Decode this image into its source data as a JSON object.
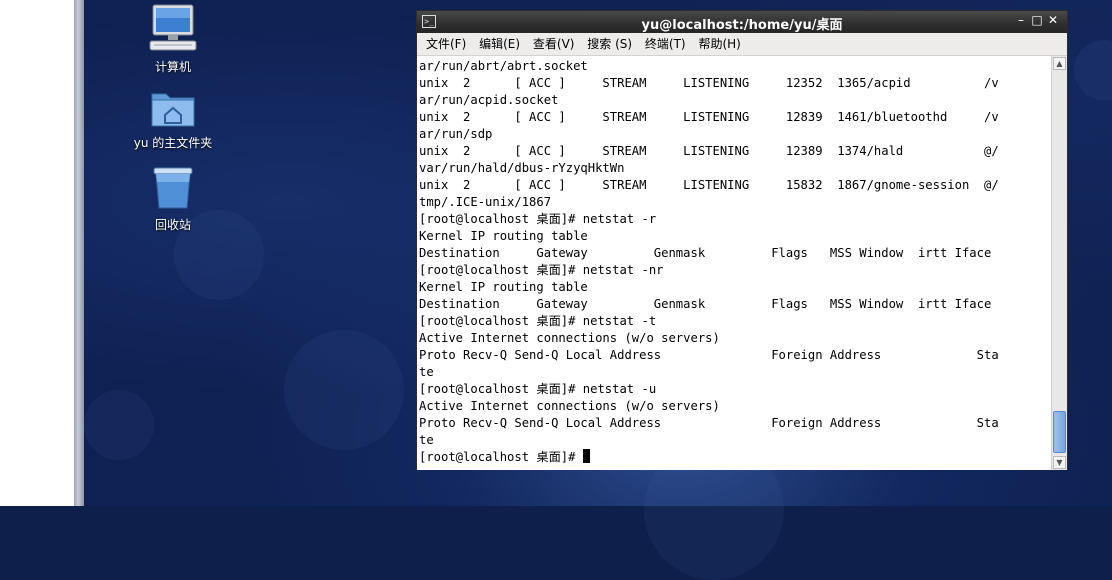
{
  "desktop": {
    "icons": [
      {
        "label": "计算机"
      },
      {
        "label": "yu 的主文件夹"
      },
      {
        "label": "回收站"
      }
    ]
  },
  "terminal": {
    "title": "yu@localhost:/home/yu/桌面",
    "menu": [
      "文件(F)",
      "编辑(E)",
      "查看(V)",
      "搜索 (S)",
      "终端(T)",
      "帮助(H)"
    ],
    "lines": [
      "ar/run/abrt/abrt.socket",
      "unix  2      [ ACC ]     STREAM     LISTENING     12352  1365/acpid          /v",
      "ar/run/acpid.socket",
      "unix  2      [ ACC ]     STREAM     LISTENING     12839  1461/bluetoothd     /v",
      "ar/run/sdp",
      "unix  2      [ ACC ]     STREAM     LISTENING     12389  1374/hald           @/",
      "var/run/hald/dbus-rYzyqHktWn",
      "unix  2      [ ACC ]     STREAM     LISTENING     15832  1867/gnome-session  @/",
      "tmp/.ICE-unix/1867",
      "[root@localhost 桌面]# netstat -r",
      "Kernel IP routing table",
      "Destination     Gateway         Genmask         Flags   MSS Window  irtt Iface",
      "[root@localhost 桌面]# netstat -nr",
      "Kernel IP routing table",
      "Destination     Gateway         Genmask         Flags   MSS Window  irtt Iface",
      "[root@localhost 桌面]# netstat -t",
      "Active Internet connections (w/o servers)",
      "Proto Recv-Q Send-Q Local Address               Foreign Address             Sta",
      "te",
      "[root@localhost 桌面]# netstat -u",
      "Active Internet connections (w/o servers)",
      "Proto Recv-Q Send-Q Local Address               Foreign Address             Sta",
      "te"
    ],
    "prompt": "[root@localhost 桌面]# "
  }
}
